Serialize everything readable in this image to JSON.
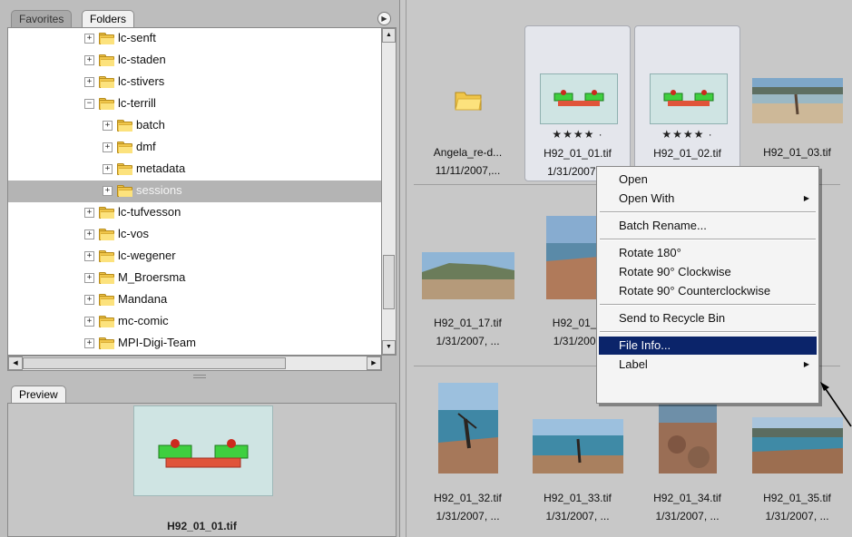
{
  "folders_panel": {
    "tabs": [
      {
        "label": "Favorites",
        "active": false
      },
      {
        "label": "Folders",
        "active": true
      }
    ],
    "tree": [
      {
        "label": "lc-senft",
        "expander": "+",
        "depth": 0,
        "selected": false
      },
      {
        "label": "lc-staden",
        "expander": "+",
        "depth": 0,
        "selected": false
      },
      {
        "label": "lc-stivers",
        "expander": "+",
        "depth": 0,
        "selected": false
      },
      {
        "label": "lc-terrill",
        "expander": "−",
        "depth": 0,
        "selected": false
      },
      {
        "label": "batch",
        "expander": "+",
        "depth": 1,
        "selected": false
      },
      {
        "label": "dmf",
        "expander": "+",
        "depth": 1,
        "selected": false
      },
      {
        "label": "metadata",
        "expander": "+",
        "depth": 1,
        "selected": false
      },
      {
        "label": "sessions",
        "expander": "+",
        "depth": 1,
        "selected": true
      },
      {
        "label": "lc-tufvesson",
        "expander": "+",
        "depth": 0,
        "selected": false
      },
      {
        "label": "lc-vos",
        "expander": "+",
        "depth": 0,
        "selected": false
      },
      {
        "label": "lc-wegener",
        "expander": "+",
        "depth": 0,
        "selected": false
      },
      {
        "label": "M_Broersma",
        "expander": "+",
        "depth": 0,
        "selected": false
      },
      {
        "label": "Mandana",
        "expander": "+",
        "depth": 0,
        "selected": false
      },
      {
        "label": "mc-comic",
        "expander": "+",
        "depth": 0,
        "selected": false
      },
      {
        "label": "MPI-Digi-Team",
        "expander": "+",
        "depth": 0,
        "selected": false
      }
    ]
  },
  "preview_panel": {
    "tab_label": "Preview",
    "caption": "H92_01_01.tif"
  },
  "content": {
    "thumbnails": [
      {
        "name": "Angela_re-d...",
        "date": "11/11/2007,...",
        "kind": "folder",
        "rating": "",
        "highlight": false
      },
      {
        "name": "H92_01_01.tif",
        "date": "1/31/2007,...",
        "kind": "green-diagram",
        "rating": "★★★★ ·",
        "highlight": true
      },
      {
        "name": "H92_01_02.tif",
        "date": "",
        "kind": "green-diagram",
        "rating": "★★★★ ·",
        "highlight": true
      },
      {
        "name": "H92_01_03.tif",
        "date": "...",
        "kind": "beach",
        "rating": "",
        "highlight": false
      },
      {
        "name": "H92_01_17.tif",
        "date": "1/31/2007, ...",
        "kind": "landscape",
        "rating": "",
        "highlight": false
      },
      {
        "name": "H92_01_1",
        "date": "1/31/2007",
        "kind": "coast-tall",
        "rating": "",
        "highlight": false
      },
      {
        "name": "",
        "date": "",
        "kind": "hidden",
        "rating": "",
        "highlight": false
      },
      {
        "name": "tif",
        "date": "...",
        "kind": "coast",
        "rating": "",
        "highlight": false
      },
      {
        "name": "H92_01_32.tif",
        "date": "1/31/2007, ...",
        "kind": "person-tall",
        "rating": "",
        "highlight": false
      },
      {
        "name": "H92_01_33.tif",
        "date": "1/31/2007, ...",
        "kind": "sea-wide",
        "rating": "",
        "highlight": false
      },
      {
        "name": "H92_01_34.tif",
        "date": "1/31/2007, ...",
        "kind": "rocks",
        "rating": "",
        "highlight": false
      },
      {
        "name": "H92_01_35.tif",
        "date": "1/31/2007, ...",
        "kind": "sea-rocks",
        "rating": "",
        "highlight": false
      }
    ]
  },
  "context_menu": {
    "items": [
      {
        "type": "item",
        "label": "Open",
        "submenu": false,
        "active": false
      },
      {
        "type": "item",
        "label": "Open With",
        "submenu": true,
        "active": false
      },
      {
        "type": "separator"
      },
      {
        "type": "item",
        "label": "Batch Rename...",
        "submenu": false,
        "active": false
      },
      {
        "type": "separator"
      },
      {
        "type": "item",
        "label": "Rotate 180°",
        "submenu": false,
        "active": false
      },
      {
        "type": "item",
        "label": "Rotate 90° Clockwise",
        "submenu": false,
        "active": false
      },
      {
        "type": "item",
        "label": "Rotate 90° Counterclockwise",
        "submenu": false,
        "active": false
      },
      {
        "type": "separator"
      },
      {
        "type": "item",
        "label": "Send to Recycle Bin",
        "submenu": false,
        "active": false
      },
      {
        "type": "separator"
      },
      {
        "type": "item",
        "label": "File Info...",
        "submenu": false,
        "active": true
      },
      {
        "type": "item",
        "label": "Label",
        "submenu": true,
        "active": false
      }
    ]
  },
  "colors": {
    "menu_highlight": "#0b246a",
    "folder_yellow": "#f0c64a",
    "selection_gray": "#b4b4b4"
  }
}
